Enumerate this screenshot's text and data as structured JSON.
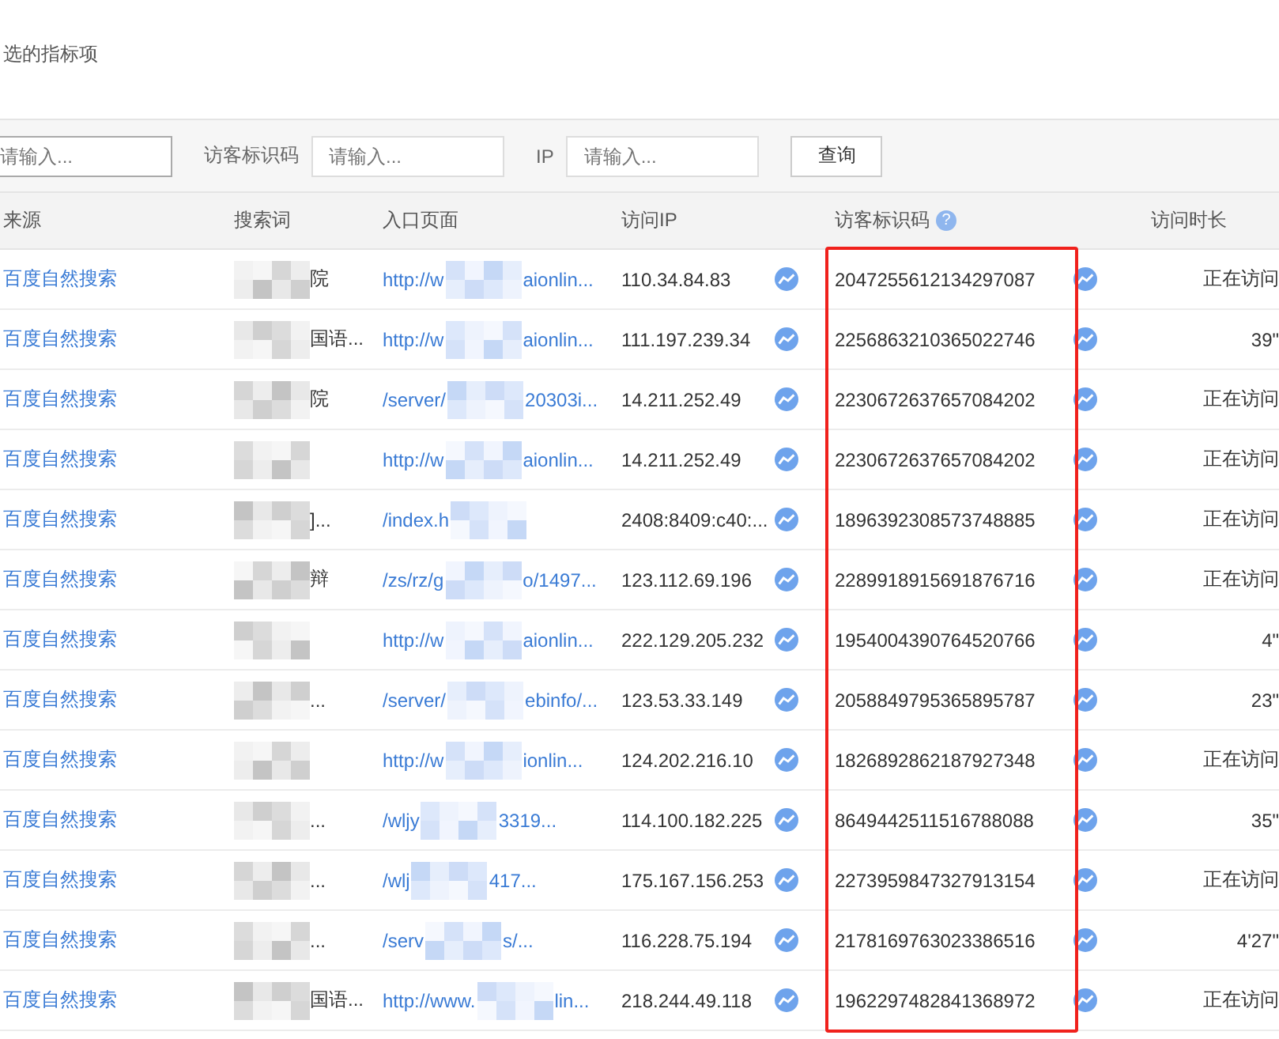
{
  "section_title": "选的指标项",
  "filters": {
    "first_input": {
      "placeholder": "请输入..."
    },
    "visitor_id_label": "访客标识码",
    "visitor_id_input": {
      "placeholder": "请输入..."
    },
    "ip_label": "IP",
    "ip_input": {
      "placeholder": "请输入..."
    },
    "query_button": "查询"
  },
  "table": {
    "columns": [
      "来源",
      "搜索词",
      "入口页面",
      "访问IP",
      "访客标识码",
      "访问时长"
    ],
    "help_mark": "?",
    "rows": [
      {
        "source": "百度自然搜索",
        "search_tail": "院",
        "entry_start": "http://w",
        "entry_end": "aionlin...",
        "ip": "110.34.84.83",
        "visitor_id": "2047255612134297087",
        "duration": "正在访问"
      },
      {
        "source": "百度自然搜索",
        "search_tail": "国语...",
        "entry_start": "http://w",
        "entry_end": "aionlin...",
        "ip": "111.197.239.34",
        "visitor_id": "2256863210365022746",
        "duration": "39\""
      },
      {
        "source": "百度自然搜索",
        "search_tail": "院",
        "entry_start": "/server/",
        "entry_end": "20303i...",
        "ip": "14.211.252.49",
        "visitor_id": "2230672637657084202",
        "duration": "正在访问"
      },
      {
        "source": "百度自然搜索",
        "entry_start": "http://w",
        "entry_end": "aionlin...",
        "ip": "14.211.252.49",
        "visitor_id": "2230672637657084202",
        "duration": "正在访问"
      },
      {
        "source": "百度自然搜索",
        "search_tail": "]...",
        "entry_start": "/index.h",
        "ip": "2408:8409:c40:...",
        "visitor_id": "1896392308573748885",
        "duration": "正在访问"
      },
      {
        "source": "百度自然搜索",
        "search_tail": "辩",
        "entry_start": "/zs/rz/g",
        "entry_end": "o/1497...",
        "ip": "123.112.69.196",
        "visitor_id": "2289918915691876716",
        "duration": "正在访问"
      },
      {
        "source": "百度自然搜索",
        "entry_start": "http://w",
        "entry_end": "aionlin...",
        "ip": "222.129.205.232",
        "visitor_id": "1954004390764520766",
        "duration": "4\""
      },
      {
        "source": "百度自然搜索",
        "search_tail": "...",
        "entry_start": "/server/",
        "entry_end": "ebinfo/...",
        "ip": "123.53.33.149",
        "visitor_id": "2058849795365895787",
        "duration": "23\""
      },
      {
        "source": "百度自然搜索",
        "entry_start": "http://w",
        "entry_end": "ionlin...",
        "ip": "124.202.216.10",
        "visitor_id": "1826892862187927348",
        "duration": "正在访问"
      },
      {
        "source": "百度自然搜索",
        "search_tail": "...",
        "entry_start": "/wljy",
        "entry_end": "3319...",
        "ip": "114.100.182.225",
        "visitor_id": "8649442511516788088",
        "duration": "35\""
      },
      {
        "source": "百度自然搜索",
        "search_tail": "...",
        "entry_start": "/wlj",
        "entry_end": "417...",
        "ip": "175.167.156.253",
        "visitor_id": "2273959847327913154",
        "duration": "正在访问"
      },
      {
        "source": "百度自然搜索",
        "search_tail": "...",
        "entry_start": "/serv",
        "entry_end": "s/...",
        "ip": "116.228.75.194",
        "visitor_id": "2178169763023386516",
        "duration": "4'27\""
      },
      {
        "source": "百度自然搜索",
        "search_tail": "国语...",
        "entry_start": "http://www.",
        "entry_end": "lin...",
        "ip": "218.244.49.118",
        "visitor_id": "1962297482841368972",
        "duration": "正在访问"
      }
    ]
  }
}
